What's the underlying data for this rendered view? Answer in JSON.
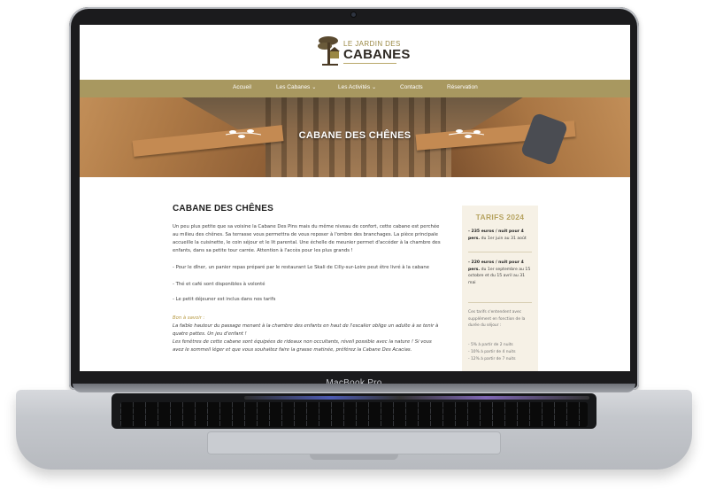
{
  "device": {
    "bezel_label": "MacBook Pro"
  },
  "site": {
    "logo": {
      "line1": "LE JARDIN DES",
      "line2": "CABANES"
    },
    "nav": [
      {
        "label": "Accueil",
        "dropdown": false
      },
      {
        "label": "Les Cabanes",
        "dropdown": true
      },
      {
        "label": "Les Activités",
        "dropdown": true
      },
      {
        "label": "Contacts",
        "dropdown": false
      },
      {
        "label": "Réservation",
        "dropdown": false
      }
    ],
    "hero_title": "CABANE DES CHÊNES",
    "page_heading": "CABANE DES CHÊNES",
    "paragraphs": {
      "intro": "Un peu plus petite que sa voisine la Cabane Des Pins mais du même niveau de confort, cette cabane est perchée au milieu des chênes. Sa terrasse vous permettra de vous reposer à l'ombre des branchages. La pièce principale accueille la cuisinette, le coin séjour et le lit parental. Une échelle de meunier permet d'accéder à la chambre des enfants, dans sa petite tour carrée. Attention à l'accès pour les plus grands !",
      "diner": "- Pour le dîner, un panier repas préparé par le restaurant Le Skali de Cilly-sur-Loire peut être livré à la cabane",
      "the": "- Thé et café sont disponibles à volonté",
      "dejeuner": "- Le petit déjeuner est inclus dans nos tarifs",
      "bon_label": "Bon à savoir :",
      "bon_text1": "La faible hauteur du passage menant à la chambre des enfants en haut de l'escalier oblige un adulte à se tenir à quatre pattes. Un jeu d'enfant !",
      "bon_text2": "Les fenêtres de cette cabane sont équipées de rideaux non occultants, réveil possible avec la nature ! Si vous avez le sommeil léger et que vous souhaitez faire la grasse matinée, préférez la Cabane Des Acacias."
    },
    "tarifs": {
      "title": "TARIFS 2024",
      "item1_price": "- 235 euros / nuit  pour 4 pers.",
      "item1_rest": " du 1er juin au 31 août",
      "item2_price": "- 220 euros / nuit  pour 4 pers.",
      "item2_rest": " du 1er septembre au 15 octobre et du 15 avril au 31 mai",
      "note1": "Ces tarifs s'entendent avec supplément en fonction de la durée du séjour :",
      "note2": "- 5% à partir de 2 nuits",
      "note3": "- 10% à partir de 4 nuits",
      "note4": "- 12% à partir de 7 nuits"
    }
  },
  "colors": {
    "nav_bar": "#a89860",
    "accent_gold": "#b7a461",
    "tarifs_bg": "#f6f1e6"
  }
}
